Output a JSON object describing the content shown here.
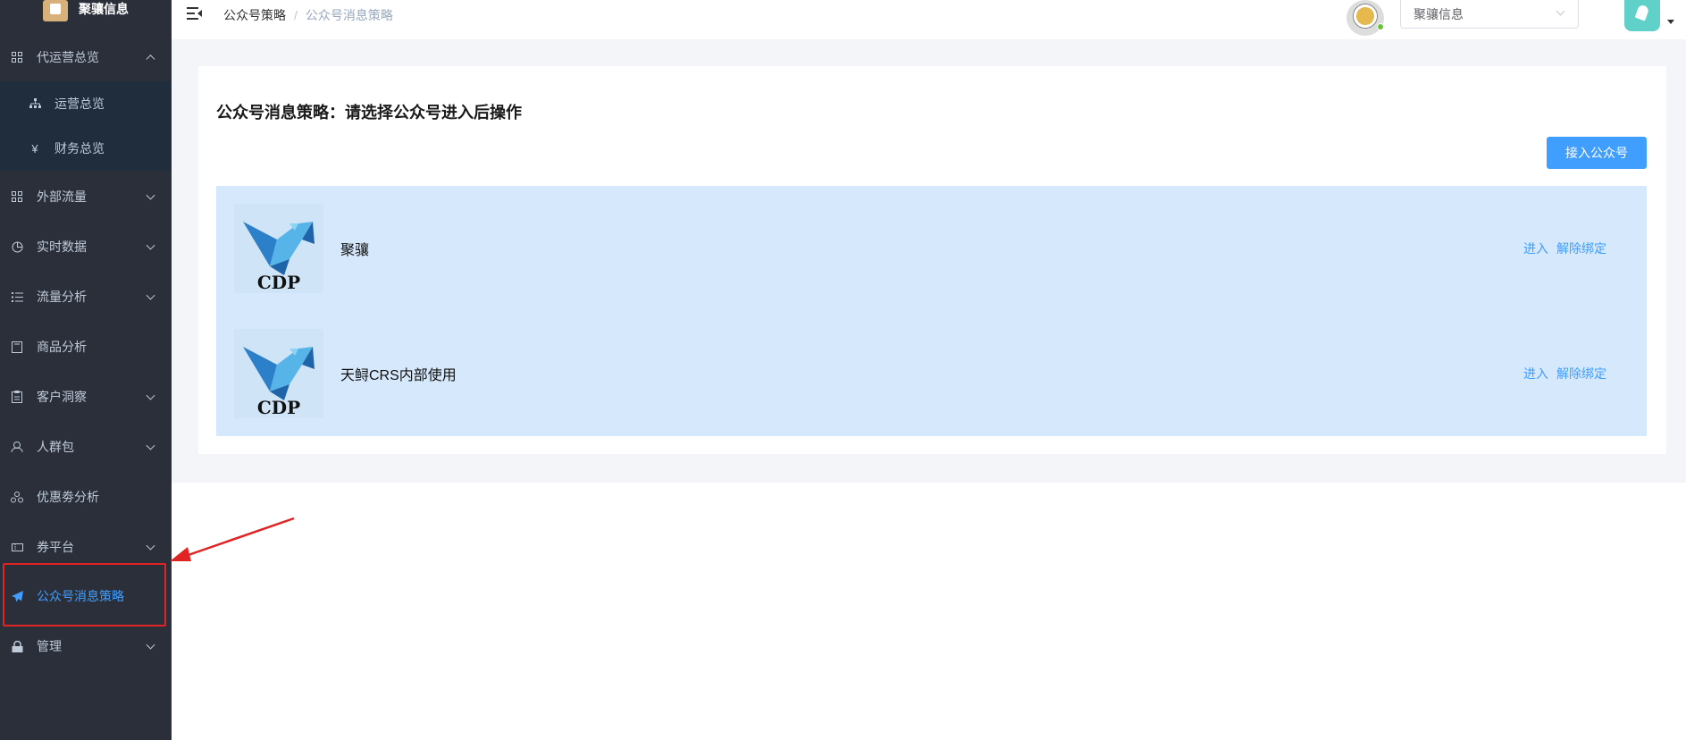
{
  "app": {
    "logo_text": "聚骧信息"
  },
  "sidebar": {
    "items": [
      {
        "label": "代运营总览",
        "icon": "grid-icon",
        "expanded": true
      },
      {
        "label": "外部流量",
        "icon": "grid-icon"
      },
      {
        "label": "实时数据",
        "icon": "pie-chart-icon"
      },
      {
        "label": "流量分析",
        "icon": "list-icon"
      },
      {
        "label": "商品分析",
        "icon": "box-icon"
      },
      {
        "label": "客户洞察",
        "icon": "clipboard-icon"
      },
      {
        "label": "人群包",
        "icon": "group-icon"
      },
      {
        "label": "优惠劵分析",
        "icon": "coupon-icon"
      },
      {
        "label": "券平台",
        "icon": "ticket-icon"
      },
      {
        "label": "公众号消息策略",
        "icon": "paper-plane-icon",
        "active": true
      },
      {
        "label": "管理",
        "icon": "lock-icon"
      }
    ],
    "subitems": [
      {
        "label": "运营总览",
        "icon": "sitemap-icon"
      },
      {
        "label": "财务总览",
        "icon": "yen-icon"
      }
    ]
  },
  "header": {
    "breadcrumb": [
      "公众号策略",
      "公众号消息策略"
    ],
    "breadcrumb_separator": "/",
    "org_select_value": "聚骧信息"
  },
  "main": {
    "title": "公众号消息策略：请选择公众号进入后操作",
    "connect_button": "接入公众号",
    "accounts": [
      {
        "name": "聚骧",
        "logo_text": "CDP",
        "enter": "进入",
        "unbind": "解除绑定"
      },
      {
        "name": "天鲟CRS内部使用",
        "logo_text": "CDP",
        "enter": "进入",
        "unbind": "解除绑定"
      }
    ]
  },
  "colors": {
    "sidebar_bg": "#2b2f3a",
    "submenu_bg": "#1f2d3d",
    "primary": "#409eff",
    "list_bg": "#d6e8fb",
    "annotation_red": "#e02424"
  }
}
